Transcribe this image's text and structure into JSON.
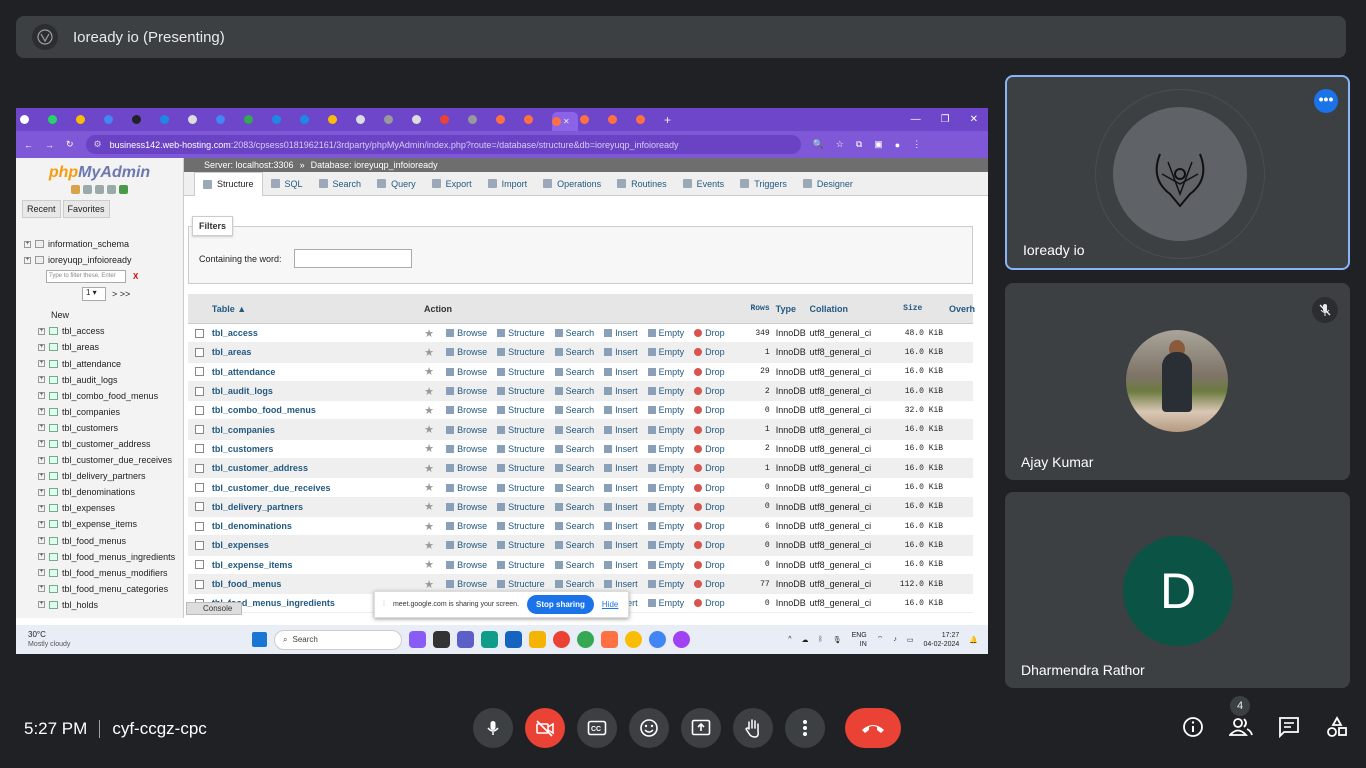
{
  "meet": {
    "presenting_title": "Ioready io (Presenting)",
    "time": "5:27 PM",
    "meeting_code": "cyf-ccgz-cpc",
    "participant_count": "4",
    "tiles": [
      {
        "name": "Ioready io",
        "avatar_icon": "ioready-logo-icon"
      },
      {
        "name": "Ajay Kumar",
        "avatar_icon": "photo-avatar"
      },
      {
        "name": "Dharmendra Rathor",
        "initial": "D",
        "avatar_color": "#0b5345"
      }
    ],
    "controls": [
      "mic-icon",
      "camera-off-icon",
      "captions-icon",
      "emoji-icon",
      "present-icon",
      "raise-hand-icon",
      "more-options-icon",
      "end-call-icon"
    ],
    "right_controls": [
      "info-icon",
      "people-icon",
      "chat-icon",
      "activities-icon"
    ]
  },
  "browser": {
    "url_host": "business142.web-hosting.com",
    "url_rest": ":2083/cpsess0181962161/3rdparty/phpMyAdmin/index.php?route=/database/structure&db=ioreyuqp_infoioready"
  },
  "pma": {
    "logo_a": "php",
    "logo_b": "MyAdmin",
    "recent": "Recent",
    "favorites": "Favorites",
    "server_crumb": "Server: localhost:3306",
    "crumb_sep": "»",
    "db_crumb": "Database: ioreyuqp_infoioready",
    "tabs": [
      "Structure",
      "SQL",
      "Search",
      "Query",
      "Export",
      "Import",
      "Operations",
      "Routines",
      "Events",
      "Triggers",
      "Designer"
    ],
    "filters_label": "Filters",
    "containing_label": "Containing the word:",
    "tree_filter_placeholder": "Type to filter these, Enter",
    "tree_filter_clear": "X",
    "pager_value": "1",
    "pager_next": "> >>",
    "tree_dbs": [
      "information_schema",
      "ioreyuqp_infoioready"
    ],
    "tree_new": "New",
    "tree_tables": [
      "tbl_access",
      "tbl_areas",
      "tbl_attendance",
      "tbl_audit_logs",
      "tbl_combo_food_menus",
      "tbl_companies",
      "tbl_customers",
      "tbl_customer_address",
      "tbl_customer_due_receives",
      "tbl_delivery_partners",
      "tbl_denominations",
      "tbl_expenses",
      "tbl_expense_items",
      "tbl_food_menus",
      "tbl_food_menus_ingredients",
      "tbl_food_menus_modifiers",
      "tbl_food_menu_categories",
      "tbl_holds"
    ],
    "headers": {
      "table": "Table",
      "action": "Action",
      "rows": "Rows",
      "type": "Type",
      "collation": "Collation",
      "size": "Size",
      "overhead": "Overh"
    },
    "actions": [
      "Browse",
      "Structure",
      "Search",
      "Insert",
      "Empty",
      "Drop"
    ],
    "rows": [
      {
        "name": "tbl_access",
        "rows": "349",
        "type": "InnoDB",
        "collation": "utf8_general_ci",
        "size": "48.0 KiB"
      },
      {
        "name": "tbl_areas",
        "rows": "1",
        "type": "InnoDB",
        "collation": "utf8_general_ci",
        "size": "16.0 KiB"
      },
      {
        "name": "tbl_attendance",
        "rows": "29",
        "type": "InnoDB",
        "collation": "utf8_general_ci",
        "size": "16.0 KiB"
      },
      {
        "name": "tbl_audit_logs",
        "rows": "2",
        "type": "InnoDB",
        "collation": "utf8_general_ci",
        "size": "16.0 KiB"
      },
      {
        "name": "tbl_combo_food_menus",
        "rows": "0",
        "type": "InnoDB",
        "collation": "utf8_general_ci",
        "size": "32.0 KiB"
      },
      {
        "name": "tbl_companies",
        "rows": "1",
        "type": "InnoDB",
        "collation": "utf8_general_ci",
        "size": "16.0 KiB"
      },
      {
        "name": "tbl_customers",
        "rows": "2",
        "type": "InnoDB",
        "collation": "utf8_general_ci",
        "size": "16.0 KiB"
      },
      {
        "name": "tbl_customer_address",
        "rows": "1",
        "type": "InnoDB",
        "collation": "utf8_general_ci",
        "size": "16.0 KiB"
      },
      {
        "name": "tbl_customer_due_receives",
        "rows": "0",
        "type": "InnoDB",
        "collation": "utf8_general_ci",
        "size": "16.0 KiB"
      },
      {
        "name": "tbl_delivery_partners",
        "rows": "0",
        "type": "InnoDB",
        "collation": "utf8_general_ci",
        "size": "16.0 KiB"
      },
      {
        "name": "tbl_denominations",
        "rows": "6",
        "type": "InnoDB",
        "collation": "utf8_general_ci",
        "size": "16.0 KiB"
      },
      {
        "name": "tbl_expenses",
        "rows": "0",
        "type": "InnoDB",
        "collation": "utf8_general_ci",
        "size": "16.0 KiB"
      },
      {
        "name": "tbl_expense_items",
        "rows": "0",
        "type": "InnoDB",
        "collation": "utf8_general_ci",
        "size": "16.0 KiB"
      },
      {
        "name": "tbl_food_menus",
        "rows": "77",
        "type": "InnoDB",
        "collation": "utf8_general_ci",
        "size": "112.0 KiB"
      },
      {
        "name": "tbl_food_menus_ingredients",
        "rows": "0",
        "type": "InnoDB",
        "collation": "utf8_general_ci",
        "size": "16.0 KiB"
      }
    ],
    "console": "Console"
  },
  "share_notice": {
    "text": "meet.google.com is sharing your screen.",
    "stop": "Stop sharing",
    "hide": "Hide"
  },
  "taskbar": {
    "temp": "30°C",
    "weather": "Mostly cloudy",
    "search": "Search",
    "lang1": "ENG",
    "lang2": "IN",
    "clock_time": "17:27",
    "clock_date": "04-02-2024"
  }
}
